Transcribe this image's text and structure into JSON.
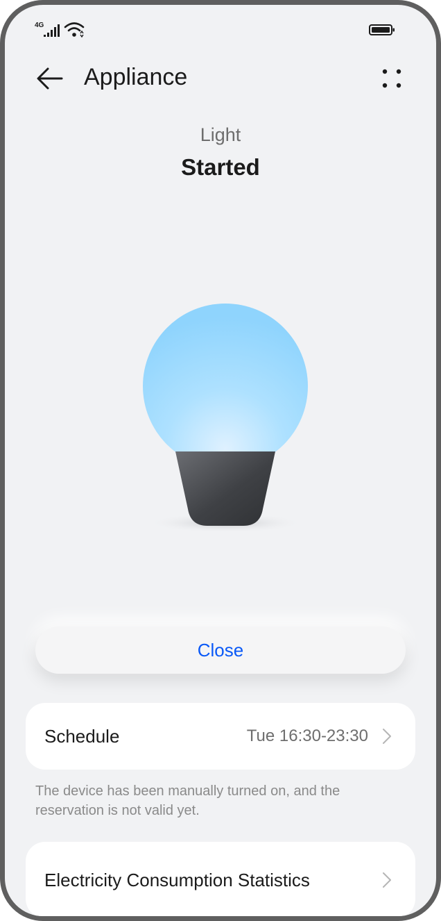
{
  "status_bar": {
    "network_type": "4G",
    "icons": [
      "signal-icon",
      "wifi-icon",
      "battery-icon"
    ]
  },
  "app_bar": {
    "title": "Appliance",
    "back_icon": "arrow-left-icon",
    "more_icon": "more-dots-icon"
  },
  "device": {
    "name": "Light",
    "status": "Started",
    "bulb_color": "#8fd4fd",
    "base_color": "#3f4145"
  },
  "actions": {
    "close_label": "Close"
  },
  "schedule": {
    "label": "Schedule",
    "value": "Tue 16:30-23:30",
    "note": "The device has been manually turned on, and the reservation is not valid yet."
  },
  "electricity": {
    "label": "Electricity Consumption Statistics"
  },
  "colors": {
    "accent": "#0a59f7",
    "background": "#f1f2f4",
    "card": "#ffffff"
  }
}
